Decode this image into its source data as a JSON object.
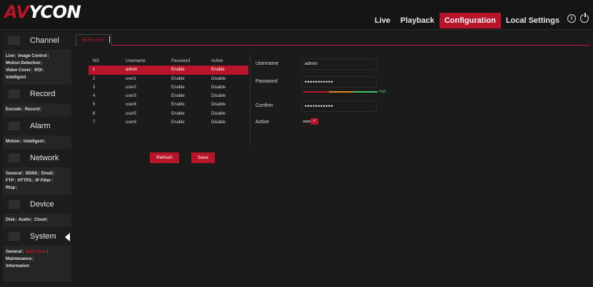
{
  "brand": {
    "logo_red": "AV",
    "logo_white": "YCON"
  },
  "nav": {
    "live": "Live",
    "playback": "Playback",
    "configuration": "Configuration",
    "local_settings": "Local Settings"
  },
  "top_icons": {
    "info": "info-icon",
    "power": "power-icon"
  },
  "colors": {
    "accent": "#b8152b",
    "background": "#1b1b1b",
    "sidebar": "#252525",
    "strength_red": "#b8152b",
    "strength_orange": "#e08a1e",
    "strength_green": "#44c06a"
  },
  "sidebar": {
    "channel": {
      "title": "Channel",
      "links": [
        "Live",
        "Image Control",
        "Motion Detection",
        "Video Cover",
        "ROI",
        "Intelligent"
      ]
    },
    "record": {
      "title": "Record",
      "links": [
        "Encode",
        "Record"
      ]
    },
    "alarm": {
      "title": "Alarm",
      "links": [
        "Motion",
        "Intelligent"
      ]
    },
    "network": {
      "title": "Network",
      "links": [
        "General",
        "DDNS",
        "Email",
        "FTP",
        "HTTPS",
        "IP Filter",
        "Rtsp"
      ]
    },
    "device": {
      "title": "Device",
      "links": [
        "Disk",
        "Audio",
        "Cloud"
      ]
    },
    "system": {
      "title": "System",
      "links": [
        "General",
        "Multi-User",
        "Maintenance",
        "Information"
      ]
    }
  },
  "tab": {
    "label": "Multi-User"
  },
  "users_table": {
    "headers": [
      "NO",
      "Username",
      "Password",
      "Active"
    ],
    "rows": [
      [
        "1",
        "admin",
        "Enable",
        "Enable"
      ],
      [
        "2",
        "user1",
        "Enable",
        "Disable"
      ],
      [
        "3",
        "user2",
        "Enable",
        "Disable"
      ],
      [
        "4",
        "user3",
        "Enable",
        "Disable"
      ],
      [
        "5",
        "user4",
        "Enable",
        "Disable"
      ],
      [
        "6",
        "user5",
        "Enable",
        "Disable"
      ],
      [
        "7",
        "user6",
        "Enable",
        "Disable"
      ]
    ],
    "selected_index": 0
  },
  "form": {
    "username_label": "Username",
    "username_value": "admin",
    "password_label": "Password",
    "password_value": "•••••••••••",
    "strength_label": "High",
    "confirm_label": "Confirm",
    "confirm_value": "•••••••••••",
    "active_label": "Active",
    "active_on": true,
    "active_check": "✓"
  },
  "buttons": {
    "refresh": "Refresh",
    "save": "Save"
  }
}
